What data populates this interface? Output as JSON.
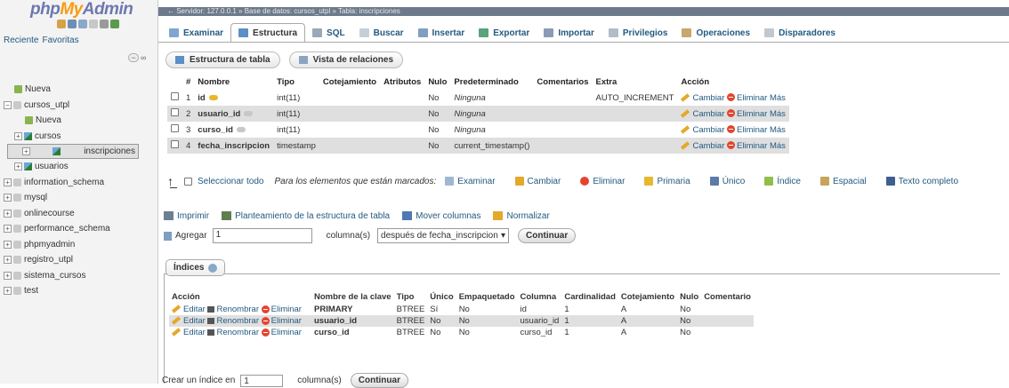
{
  "sidebar": {
    "logo_php": "php",
    "logo_my": "My",
    "logo_admin": "Admin",
    "tab_recent": "Reciente",
    "tab_favorites": "Favoritas",
    "tree": [
      {
        "label": "Nueva",
        "level": 1,
        "icon": "new-icon",
        "toggle": ""
      },
      {
        "label": "cursos_utpl",
        "level": 0,
        "icon": "database-icon",
        "toggle": "−"
      },
      {
        "label": "Nueva",
        "level": 2,
        "icon": "new-icon",
        "toggle": ""
      },
      {
        "label": "cursos",
        "level": 1,
        "icon": "table-icon",
        "toggle": "+"
      },
      {
        "label": "inscripciones",
        "level": 1,
        "icon": "table-icon",
        "toggle": "+",
        "selected": true
      },
      {
        "label": "usuarios",
        "level": 1,
        "icon": "table-icon",
        "toggle": "+"
      },
      {
        "label": "information_schema",
        "level": 0,
        "icon": "database-icon",
        "toggle": "+"
      },
      {
        "label": "mysql",
        "level": 0,
        "icon": "database-icon",
        "toggle": "+"
      },
      {
        "label": "onlinecourse",
        "level": 0,
        "icon": "database-icon",
        "toggle": "+"
      },
      {
        "label": "performance_schema",
        "level": 0,
        "icon": "database-icon",
        "toggle": "+"
      },
      {
        "label": "phpmyadmin",
        "level": 0,
        "icon": "database-icon",
        "toggle": "+"
      },
      {
        "label": "registro_utpl",
        "level": 0,
        "icon": "database-icon",
        "toggle": "+"
      },
      {
        "label": "sistema_cursos",
        "level": 0,
        "icon": "database-icon",
        "toggle": "+"
      },
      {
        "label": "test",
        "level": 0,
        "icon": "database-icon",
        "toggle": "+"
      }
    ]
  },
  "breadcrumb": "←  Servidor: 127.0.0.1  »  Base de datos: cursos_utpl  »  Tabla: inscripciones",
  "tabs": [
    {
      "label": "Examinar",
      "icon": "browse-icon",
      "color": "#7fa6cf"
    },
    {
      "label": "Estructura",
      "icon": "structure-icon",
      "color": "#5c8fc6",
      "active": true
    },
    {
      "label": "SQL",
      "icon": "sql-icon",
      "color": "#9aa8b8"
    },
    {
      "label": "Buscar",
      "icon": "search-icon",
      "color": "#c6cfd8"
    },
    {
      "label": "Insertar",
      "icon": "insert-icon",
      "color": "#7f9fc0"
    },
    {
      "label": "Exportar",
      "icon": "export-icon",
      "color": "#5aa37d"
    },
    {
      "label": "Importar",
      "icon": "import-icon",
      "color": "#8a9bb4"
    },
    {
      "label": "Privilegios",
      "icon": "privileges-icon",
      "color": "#b0bcc8"
    },
    {
      "label": "Operaciones",
      "icon": "operations-icon",
      "color": "#c9a66b"
    },
    {
      "label": "Disparadores",
      "icon": "triggers-icon",
      "color": "#c0c8d0"
    }
  ],
  "subtabs": [
    "Estructura de tabla",
    "Vista de relaciones"
  ],
  "structure": {
    "headers": [
      "#",
      "Nombre",
      "Tipo",
      "Cotejamiento",
      "Atributos",
      "Nulo",
      "Predeterminado",
      "Comentarios",
      "Extra",
      "Acción"
    ],
    "rows": [
      {
        "num": "1",
        "name": "id",
        "key": "primary",
        "type": "int(11)",
        "collation": "",
        "attributes": "",
        "null": "No",
        "default": "Ninguna",
        "comments": "",
        "extra": "AUTO_INCREMENT"
      },
      {
        "num": "2",
        "name": "usuario_id",
        "key": "index",
        "type": "int(11)",
        "collation": "",
        "attributes": "",
        "null": "No",
        "default": "Ninguna",
        "comments": "",
        "extra": ""
      },
      {
        "num": "3",
        "name": "curso_id",
        "key": "index",
        "type": "int(11)",
        "collation": "",
        "attributes": "",
        "null": "No",
        "default": "Ninguna",
        "comments": "",
        "extra": ""
      },
      {
        "num": "4",
        "name": "fecha_inscripcion",
        "key": "",
        "type": "timestamp",
        "collation": "",
        "attributes": "",
        "null": "No",
        "default": "current_timestamp()",
        "comments": "",
        "extra": ""
      }
    ],
    "action_change": "Cambiar",
    "action_delete": "Eliminar",
    "action_more": "Más"
  },
  "selection": {
    "select_all": "Seleccionar todo",
    "marked_label": "Para los elementos que están marcados:",
    "ops": [
      {
        "label": "Examinar",
        "icon": "browse-icon",
        "color": "#9fb7d3"
      },
      {
        "label": "Cambiar",
        "icon": "pencil-icon",
        "color": "#e5a82a"
      },
      {
        "label": "Eliminar",
        "icon": "delete-icon",
        "color": "#e4442f"
      },
      {
        "label": "Primaria",
        "icon": "key-icon",
        "color": "#e6b82e"
      },
      {
        "label": "Único",
        "icon": "unique-icon",
        "color": "#5c7aa6"
      },
      {
        "label": "Índice",
        "icon": "index-icon",
        "color": "#8fbf4a"
      },
      {
        "label": "Espacial",
        "icon": "spatial-icon",
        "color": "#c7a45a"
      },
      {
        "label": "Texto completo",
        "icon": "fulltext-icon",
        "color": "#3d5f8f"
      }
    ]
  },
  "ops2": [
    {
      "label": "Imprimir",
      "icon": "print-icon"
    },
    {
      "label": "Planteamiento de la estructura de tabla",
      "icon": "propose-icon"
    },
    {
      "label": "Mover columnas",
      "icon": "move-columns-icon"
    },
    {
      "label": "Normalizar",
      "icon": "normalize-icon"
    }
  ],
  "add": {
    "label": "Agregar",
    "value": "1",
    "columns_label": "columna(s)",
    "position": "después de fecha_inscripcion",
    "button": "Continuar"
  },
  "indexes": {
    "legend": "Índices",
    "headers": [
      "Acción",
      "Nombre de la clave",
      "Tipo",
      "Único",
      "Empaquetado",
      "Columna",
      "Cardinalidad",
      "Cotejamiento",
      "Nulo",
      "Comentario"
    ],
    "edit": "Editar",
    "rename": "Renombrar",
    "delete": "Eliminar",
    "rows": [
      {
        "key": "PRIMARY",
        "type": "BTREE",
        "unique": "Sí",
        "packed": "No",
        "column": "id",
        "cardinality": "1",
        "collation": "A",
        "null": "No",
        "comment": ""
      },
      {
        "key": "usuario_id",
        "type": "BTREE",
        "unique": "No",
        "packed": "No",
        "column": "usuario_id",
        "cardinality": "1",
        "collation": "A",
        "null": "No",
        "comment": ""
      },
      {
        "key": "curso_id",
        "type": "BTREE",
        "unique": "No",
        "packed": "No",
        "column": "curso_id",
        "cardinality": "1",
        "collation": "A",
        "null": "No",
        "comment": ""
      }
    ]
  },
  "create_index": {
    "label": "Crear un índice en",
    "value": "1",
    "columns_label": "columna(s)",
    "button": "Continuar"
  }
}
